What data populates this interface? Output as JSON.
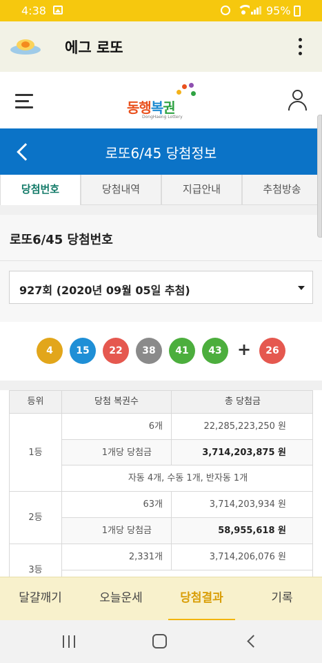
{
  "status_bar": {
    "time": "4:38",
    "battery": "95%"
  },
  "app_bar": {
    "title": "에그 로또"
  },
  "site_header": {
    "logo_text_1": "동행",
    "logo_text_2": "복",
    "logo_text_3": "권",
    "logo_sub": "DongHaeng Lottery"
  },
  "title_bar": {
    "title": "로또6/45 당첨정보"
  },
  "tabs": [
    {
      "label": "당첨번호",
      "active": true
    },
    {
      "label": "당첨내역",
      "active": false
    },
    {
      "label": "지급안내",
      "active": false
    },
    {
      "label": "추첨방송",
      "active": false
    }
  ],
  "section": {
    "title": "로또6/45 당첨번호"
  },
  "draw_select": {
    "value": "927회 (2020년 09월 05일 추첨)"
  },
  "winning_numbers": {
    "main": [
      "4",
      "15",
      "22",
      "38",
      "41",
      "43"
    ],
    "plus": "+",
    "bonus": "26",
    "colors": [
      "#e2a61b",
      "#1f8fd6",
      "#e5584f",
      "#8a8a8a",
      "#4cae3d",
      "#4cae3d",
      "#e5584f"
    ]
  },
  "prize_table": {
    "headers": [
      "등위",
      "당첨 복권수",
      "총 당첨금"
    ],
    "rows": [
      {
        "rank": "1등",
        "count": "6개",
        "total": "22,285,223,250 원",
        "per_label": "1개당 당첨금",
        "per_amount": "3,714,203,875 원",
        "note": "자동 4개, 수동 1개, 반자동 1개"
      },
      {
        "rank": "2등",
        "count": "63개",
        "total": "3,714,203,934 원",
        "per_label": "1개당 당첨금",
        "per_amount": "58,955,618 원"
      },
      {
        "rank": "3등",
        "count": "2,331개",
        "total": "3,714,206,076 원"
      }
    ]
  },
  "bottom_nav": [
    {
      "label": "달걀깨기",
      "active": false
    },
    {
      "label": "오늘운세",
      "active": false
    },
    {
      "label": "당첨결과",
      "active": true
    },
    {
      "label": "기록",
      "active": false
    }
  ]
}
